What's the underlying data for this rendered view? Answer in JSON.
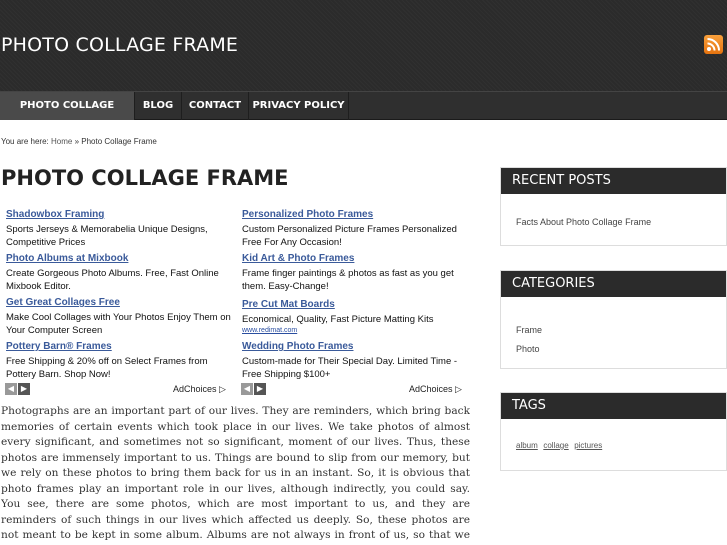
{
  "site": {
    "title": "PHOTO COLLAGE FRAME",
    "rss_icon": "rss-icon"
  },
  "nav": {
    "items": [
      {
        "label": "PHOTO COLLAGE FRAME",
        "active": true
      },
      {
        "label": "BLOG"
      },
      {
        "label": "CONTACT"
      },
      {
        "label": "PRIVACY POLICY"
      }
    ]
  },
  "breadcrumb": {
    "prefix": "You are here:",
    "home": "Home",
    "sep": "»",
    "current": "Photo Collage Frame"
  },
  "page": {
    "title": "PHOTO COLLAGE FRAME"
  },
  "ads": {
    "left": [
      {
        "title": "Shadowbox Framing",
        "text": "Sports Jerseys & Memorabelia Unique Designs, Competitive Prices"
      },
      {
        "title": "Photo Albums at Mixbook",
        "text": "Create Gorgeous Photo Albums. Free, Fast Online Mixbook Editor."
      },
      {
        "title": "Get Great Collages Free",
        "text": "Make Cool Collages with Your Photos Enjoy Them on Your Computer Screen"
      },
      {
        "title": "Pottery Barn® Frames",
        "text": "Free Shipping & 20% off on Select Frames from Pottery Barn. Shop Now!"
      }
    ],
    "right": [
      {
        "title": "Personalized Photo Frames",
        "text": "Custom Personalized Picture Frames Personalized Free For Any Occasion!"
      },
      {
        "title": "Kid Art & Photo Frames",
        "text": "Frame finger paintings & photos as fast as you get them. Easy-Change!"
      },
      {
        "title": "Pre Cut Mat Boards",
        "text": "Economical, Quality, Fast Picture Matting Kits",
        "url": "www.redimat.com"
      },
      {
        "title": "Wedding Photo Frames",
        "text": "Custom-made for Their Special Day. Limited Time - Free Shipping $100+"
      }
    ],
    "adchoices": "AdChoices ▷",
    "prev_icon": "chevron-left-icon",
    "next_icon": "chevron-right-icon"
  },
  "article": {
    "text": "Photographs are an important part of our lives. They are reminders, which bring back memories of certain events which took place in our lives. We take photos of almost every significant, and sometimes not so significant, moment of our lives. Thus, these photos are immensely important to us. Things are bound to slip from our memory, but we rely on these photos to bring them back for us in an instant. So, it is obvious that photo frames play an important role in our lives, although indirectly, you could say. You see, there are some photos, which are most important to us, and they are reminders of such things in our lives which affected us deeply. So, these photos are not meant to be kept in some album. Albums are not always in front of us, so that we might leaf through them at every possible instance. So, frames are needed for these photos. Frames can bring out a certain beauty in each photo and also serve as a way to preserve the memories they hold."
  },
  "sidebar": {
    "recent": {
      "title": "RECENT POSTS",
      "items": [
        "Facts About Photo Collage Frame"
      ]
    },
    "categories": {
      "title": "CATEGORIES",
      "items": [
        "Frame",
        "Photo"
      ]
    },
    "tags": {
      "title": "TAGS",
      "items": [
        "album",
        "collage",
        "pictures"
      ]
    }
  },
  "colors": {
    "header_bg": "#2b2b2b",
    "ad_link": "#3a5a9a",
    "rss": "#f08a24"
  }
}
